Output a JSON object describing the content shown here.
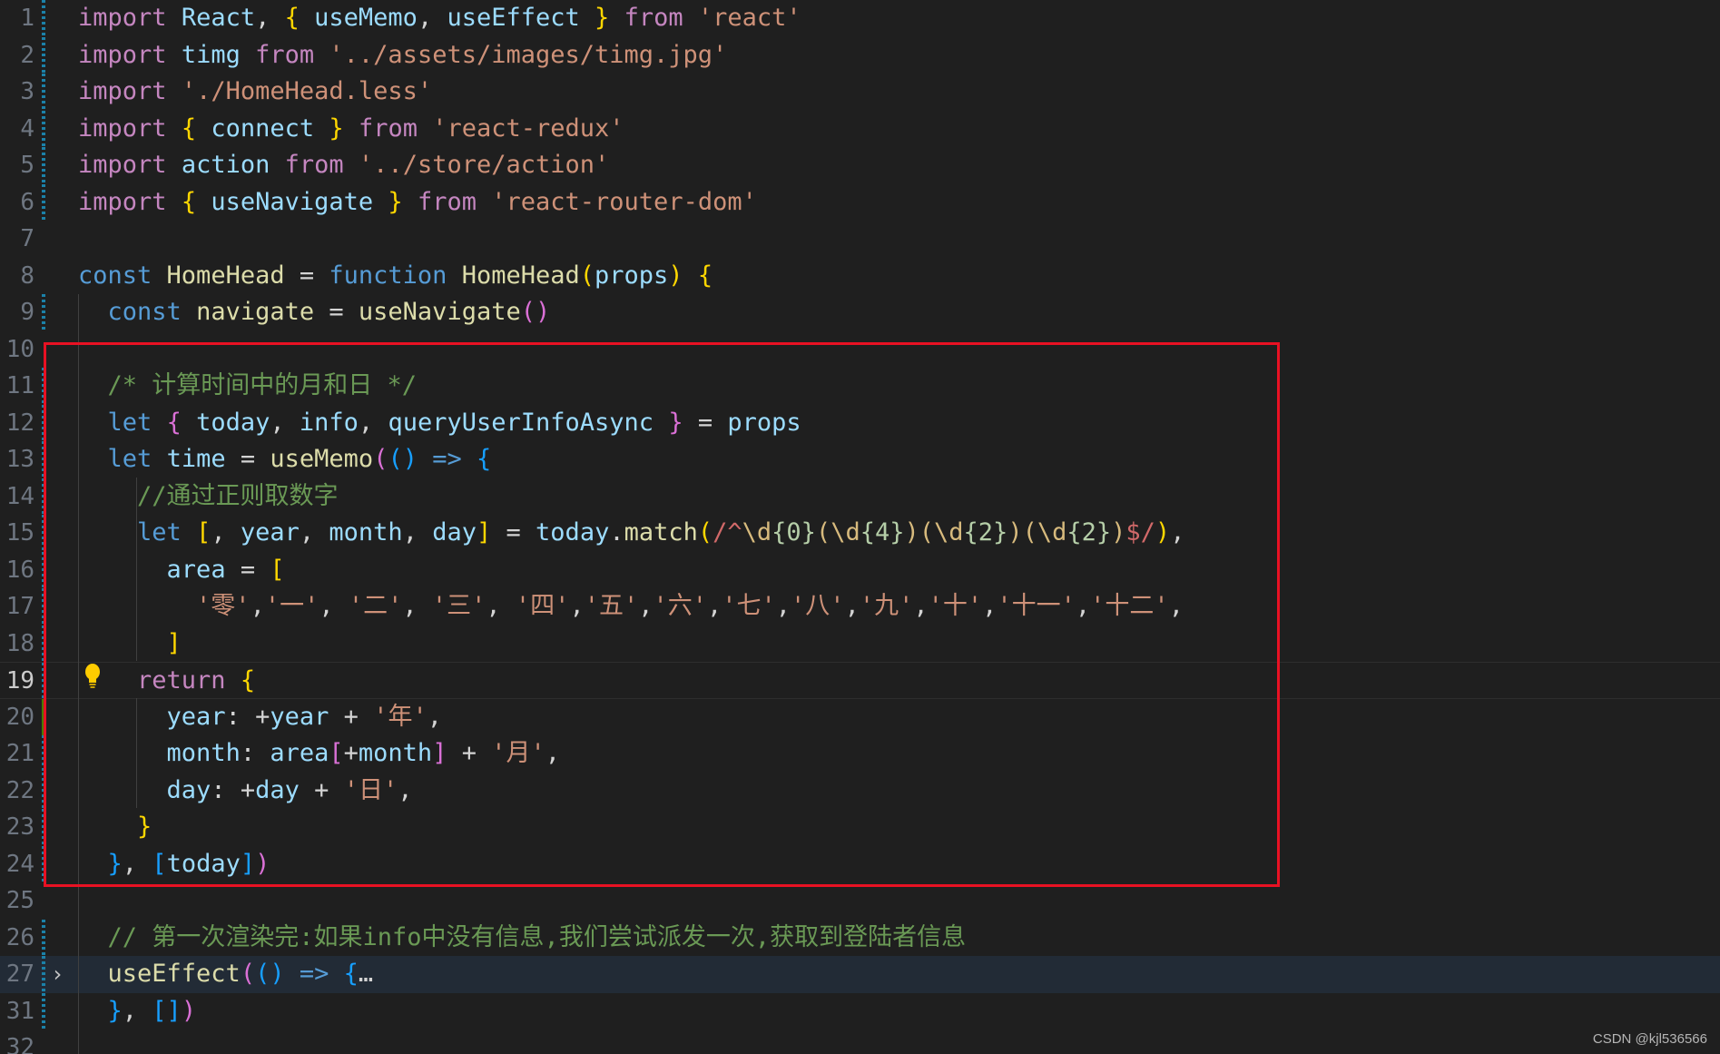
{
  "editor": {
    "theme": "dark",
    "colors": {
      "background": "#1f1f1f",
      "highlight_box": "#e81123",
      "git_modified": "#1b81a8",
      "git_added": "#487e02"
    },
    "lines": [
      {
        "num": "1",
        "git": "mod",
        "tokens": [
          [
            "kw",
            "import"
          ],
          [
            "def",
            " "
          ],
          [
            "var",
            "React"
          ],
          [
            "def",
            ", "
          ],
          [
            "b1",
            "{"
          ],
          [
            "def",
            " "
          ],
          [
            "var",
            "useMemo"
          ],
          [
            "def",
            ", "
          ],
          [
            "var",
            "useEffect"
          ],
          [
            "def",
            " "
          ],
          [
            "b1",
            "}"
          ],
          [
            "def",
            " "
          ],
          [
            "kw",
            "from"
          ],
          [
            "def",
            " "
          ],
          [
            "st",
            "'react'"
          ]
        ]
      },
      {
        "num": "2",
        "git": "mod",
        "tokens": [
          [
            "kw",
            "import"
          ],
          [
            "def",
            " "
          ],
          [
            "var",
            "timg"
          ],
          [
            "def",
            " "
          ],
          [
            "kw",
            "from"
          ],
          [
            "def",
            " "
          ],
          [
            "st",
            "'../assets/images/timg.jpg'"
          ]
        ]
      },
      {
        "num": "3",
        "git": "mod",
        "tokens": [
          [
            "kw",
            "import"
          ],
          [
            "def",
            " "
          ],
          [
            "st",
            "'./HomeHead.less'"
          ]
        ]
      },
      {
        "num": "4",
        "git": "mod",
        "tokens": [
          [
            "kw",
            "import"
          ],
          [
            "def",
            " "
          ],
          [
            "b1",
            "{"
          ],
          [
            "def",
            " "
          ],
          [
            "var",
            "connect"
          ],
          [
            "def",
            " "
          ],
          [
            "b1",
            "}"
          ],
          [
            "def",
            " "
          ],
          [
            "kw",
            "from"
          ],
          [
            "def",
            " "
          ],
          [
            "st",
            "'react-redux'"
          ]
        ]
      },
      {
        "num": "5",
        "git": "mod",
        "tokens": [
          [
            "kw",
            "import"
          ],
          [
            "def",
            " "
          ],
          [
            "var",
            "action"
          ],
          [
            "def",
            " "
          ],
          [
            "kw",
            "from"
          ],
          [
            "def",
            " "
          ],
          [
            "st",
            "'../store/action'"
          ]
        ]
      },
      {
        "num": "6",
        "git": "mod",
        "tokens": [
          [
            "kw",
            "import"
          ],
          [
            "def",
            " "
          ],
          [
            "b1",
            "{"
          ],
          [
            "def",
            " "
          ],
          [
            "var",
            "useNavigate"
          ],
          [
            "def",
            " "
          ],
          [
            "b1",
            "}"
          ],
          [
            "def",
            " "
          ],
          [
            "kw",
            "from"
          ],
          [
            "def",
            " "
          ],
          [
            "st",
            "'react-router-dom'"
          ]
        ]
      },
      {
        "num": "7",
        "git": "",
        "tokens": []
      },
      {
        "num": "8",
        "git": "",
        "tokens": [
          [
            "dec",
            "const"
          ],
          [
            "def",
            " "
          ],
          [
            "fn",
            "HomeHead"
          ],
          [
            "def",
            " "
          ],
          [
            "op",
            "="
          ],
          [
            "def",
            " "
          ],
          [
            "dec",
            "function"
          ],
          [
            "def",
            " "
          ],
          [
            "fn",
            "HomeHead"
          ],
          [
            "b1",
            "("
          ],
          [
            "var",
            "props"
          ],
          [
            "b1",
            ")"
          ],
          [
            "def",
            " "
          ],
          [
            "b1",
            "{"
          ]
        ]
      },
      {
        "num": "9",
        "git": "mod",
        "tokens": [
          [
            "def",
            "  "
          ],
          [
            "dec",
            "const"
          ],
          [
            "def",
            " "
          ],
          [
            "fn",
            "navigate"
          ],
          [
            "def",
            " "
          ],
          [
            "op",
            "="
          ],
          [
            "def",
            " "
          ],
          [
            "fn",
            "useNavigate"
          ],
          [
            "b2",
            "()"
          ]
        ]
      },
      {
        "num": "10",
        "git": "",
        "tokens": []
      },
      {
        "num": "11",
        "git": "mod",
        "tokens": [
          [
            "def",
            "  "
          ],
          [
            "cm",
            "/* 计算时间中的月和日 */"
          ]
        ]
      },
      {
        "num": "12",
        "git": "mod",
        "tokens": [
          [
            "def",
            "  "
          ],
          [
            "dec",
            "let"
          ],
          [
            "def",
            " "
          ],
          [
            "b2",
            "{"
          ],
          [
            "def",
            " "
          ],
          [
            "var",
            "today"
          ],
          [
            "def",
            ", "
          ],
          [
            "var",
            "info"
          ],
          [
            "def",
            ", "
          ],
          [
            "var",
            "queryUserInfoAsync"
          ],
          [
            "def",
            " "
          ],
          [
            "b2",
            "}"
          ],
          [
            "def",
            " "
          ],
          [
            "op",
            "="
          ],
          [
            "def",
            " "
          ],
          [
            "var",
            "props"
          ]
        ]
      },
      {
        "num": "13",
        "git": "mod",
        "tokens": [
          [
            "def",
            "  "
          ],
          [
            "dec",
            "let"
          ],
          [
            "def",
            " "
          ],
          [
            "var",
            "time"
          ],
          [
            "def",
            " "
          ],
          [
            "op",
            "="
          ],
          [
            "def",
            " "
          ],
          [
            "fn",
            "useMemo"
          ],
          [
            "b2",
            "("
          ],
          [
            "b3",
            "()"
          ],
          [
            "def",
            " "
          ],
          [
            "dec",
            "=>"
          ],
          [
            "def",
            " "
          ],
          [
            "b3",
            "{"
          ]
        ]
      },
      {
        "num": "14",
        "git": "mod",
        "tokens": [
          [
            "def",
            "    "
          ],
          [
            "cm",
            "//通过正则取数字"
          ]
        ]
      },
      {
        "num": "15",
        "git": "mod",
        "tokens": [
          [
            "def",
            "    "
          ],
          [
            "dec",
            "let"
          ],
          [
            "def",
            " "
          ],
          [
            "b1",
            "["
          ],
          [
            "def",
            ", "
          ],
          [
            "var",
            "year"
          ],
          [
            "def",
            ", "
          ],
          [
            "var",
            "month"
          ],
          [
            "def",
            ", "
          ],
          [
            "var",
            "day"
          ],
          [
            "b1",
            "]"
          ],
          [
            "def",
            " "
          ],
          [
            "op",
            "="
          ],
          [
            "def",
            " "
          ],
          [
            "var",
            "today"
          ],
          [
            "def",
            "."
          ],
          [
            "fn",
            "match"
          ],
          [
            "b1",
            "("
          ],
          [
            "rx",
            "/^"
          ],
          [
            "re",
            "\\d"
          ],
          [
            "num",
            "{0}"
          ],
          [
            "re",
            "("
          ],
          [
            "re",
            "\\d"
          ],
          [
            "num",
            "{4}"
          ],
          [
            "re",
            ")("
          ],
          [
            "re",
            "\\d"
          ],
          [
            "num",
            "{2}"
          ],
          [
            "re",
            ")("
          ],
          [
            "re",
            "\\d"
          ],
          [
            "num",
            "{2}"
          ],
          [
            "re",
            ")"
          ],
          [
            "rx",
            "$/"
          ],
          [
            "b1",
            ")"
          ],
          [
            "def",
            ","
          ]
        ]
      },
      {
        "num": "16",
        "git": "mod",
        "tokens": [
          [
            "def",
            "      "
          ],
          [
            "var",
            "area"
          ],
          [
            "def",
            " "
          ],
          [
            "op",
            "="
          ],
          [
            "def",
            " "
          ],
          [
            "b1",
            "["
          ]
        ]
      },
      {
        "num": "17",
        "git": "mod",
        "tokens": [
          [
            "def",
            "        "
          ],
          [
            "st",
            "'零'"
          ],
          [
            "def",
            ","
          ],
          [
            "st",
            "'一'"
          ],
          [
            "def",
            ", "
          ],
          [
            "st",
            "'二'"
          ],
          [
            "def",
            ", "
          ],
          [
            "st",
            "'三'"
          ],
          [
            "def",
            ", "
          ],
          [
            "st",
            "'四'"
          ],
          [
            "def",
            ","
          ],
          [
            "st",
            "'五'"
          ],
          [
            "def",
            ","
          ],
          [
            "st",
            "'六'"
          ],
          [
            "def",
            ","
          ],
          [
            "st",
            "'七'"
          ],
          [
            "def",
            ","
          ],
          [
            "st",
            "'八'"
          ],
          [
            "def",
            ","
          ],
          [
            "st",
            "'九'"
          ],
          [
            "def",
            ","
          ],
          [
            "st",
            "'十'"
          ],
          [
            "def",
            ","
          ],
          [
            "st",
            "'十一'"
          ],
          [
            "def",
            ","
          ],
          [
            "st",
            "'十二'"
          ],
          [
            "def",
            ","
          ]
        ]
      },
      {
        "num": "18",
        "git": "mod",
        "tokens": [
          [
            "def",
            "      "
          ],
          [
            "b1",
            "]"
          ]
        ]
      },
      {
        "num": "19",
        "git": "mod",
        "current": true,
        "tokens": [
          [
            "def",
            "    "
          ],
          [
            "kw",
            "return"
          ],
          [
            "def",
            " "
          ],
          [
            "b1",
            "{"
          ]
        ]
      },
      {
        "num": "20",
        "git": "add",
        "tokens": [
          [
            "def",
            "      "
          ],
          [
            "var",
            "year"
          ],
          [
            "def",
            ": "
          ],
          [
            "op",
            "+"
          ],
          [
            "var",
            "year"
          ],
          [
            "def",
            " "
          ],
          [
            "op",
            "+"
          ],
          [
            "def",
            " "
          ],
          [
            "st",
            "'年'"
          ],
          [
            "def",
            ","
          ]
        ]
      },
      {
        "num": "21",
        "git": "mod",
        "tokens": [
          [
            "def",
            "      "
          ],
          [
            "var",
            "month"
          ],
          [
            "def",
            ": "
          ],
          [
            "var",
            "area"
          ],
          [
            "b2",
            "["
          ],
          [
            "op",
            "+"
          ],
          [
            "var",
            "month"
          ],
          [
            "b2",
            "]"
          ],
          [
            "def",
            " "
          ],
          [
            "op",
            "+"
          ],
          [
            "def",
            " "
          ],
          [
            "st",
            "'月'"
          ],
          [
            "def",
            ","
          ]
        ]
      },
      {
        "num": "22",
        "git": "mod",
        "tokens": [
          [
            "def",
            "      "
          ],
          [
            "var",
            "day"
          ],
          [
            "def",
            ": "
          ],
          [
            "op",
            "+"
          ],
          [
            "var",
            "day"
          ],
          [
            "def",
            " "
          ],
          [
            "op",
            "+"
          ],
          [
            "def",
            " "
          ],
          [
            "st",
            "'日'"
          ],
          [
            "def",
            ","
          ]
        ]
      },
      {
        "num": "23",
        "git": "mod",
        "tokens": [
          [
            "def",
            "    "
          ],
          [
            "b1",
            "}"
          ]
        ]
      },
      {
        "num": "24",
        "git": "mod",
        "tokens": [
          [
            "def",
            "  "
          ],
          [
            "b3",
            "}"
          ],
          [
            "def",
            ", "
          ],
          [
            "b3",
            "["
          ],
          [
            "var",
            "today"
          ],
          [
            "b3",
            "]"
          ],
          [
            "b2",
            ")"
          ]
        ]
      },
      {
        "num": "25",
        "git": "",
        "tokens": []
      },
      {
        "num": "26",
        "git": "mod",
        "tokens": [
          [
            "def",
            "  "
          ],
          [
            "cm",
            "// 第一次渲染完:如果info中没有信息,我们尝试派发一次,获取到登陆者信息"
          ]
        ]
      },
      {
        "num": "27",
        "git": "mod",
        "folded": true,
        "tokens": [
          [
            "def",
            "  "
          ],
          [
            "fn",
            "useEffect"
          ],
          [
            "b2",
            "("
          ],
          [
            "b3",
            "()"
          ],
          [
            "def",
            " "
          ],
          [
            "dec",
            "=>"
          ],
          [
            "def",
            " "
          ],
          [
            "b3",
            "{"
          ],
          [
            "def",
            "…"
          ]
        ]
      },
      {
        "num": "31",
        "git": "mod",
        "tokens": [
          [
            "def",
            "  "
          ],
          [
            "b3",
            "}"
          ],
          [
            "def",
            ", "
          ],
          [
            "b3",
            "[]"
          ],
          [
            "b2",
            ")"
          ]
        ]
      },
      {
        "num": "32",
        "git": "",
        "tokens": []
      }
    ]
  },
  "fold_icon": "chevron-right-icon",
  "lightbulb_icon": "lightbulb-icon",
  "watermark": "CSDN @kjl536566"
}
